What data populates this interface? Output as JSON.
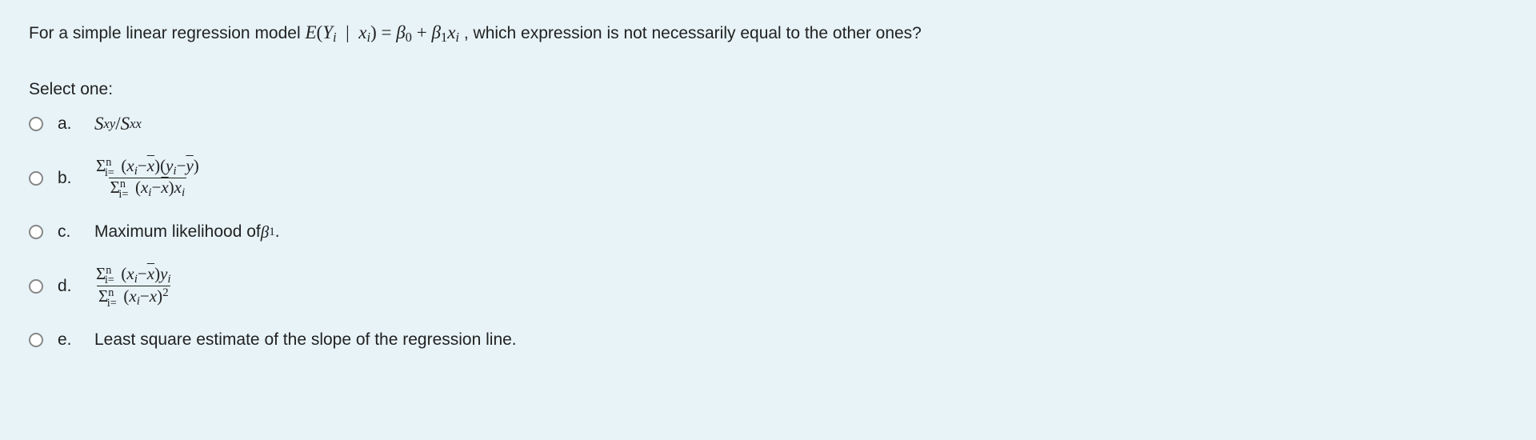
{
  "question": {
    "prefix": "For a simple linear regression model ",
    "formula_html": "<span class='math-i'>E</span>(<span class='math-i'>Y</span><span class='sub'>i</span> &nbsp;|&nbsp; <span class='math-i'>x</span><span class='sub'>i</span>) = <span class='math-i'>β</span><span class='sub' style='font-style:normal'>0</span> + <span class='math-i'>β</span><span class='sub' style='font-style:normal'>1</span><span class='math-i'>x</span><span class='sub'>i</span>",
    "suffix": ", which expression is not necessarily equal to the other ones?"
  },
  "select_one": "Select one:",
  "options": {
    "a": {
      "letter": "a.",
      "content_html": "<span class='math-i'>S</span><span class='sub'>xy</span>/<span class='math-i'>S</span><span class='sub'>xx</span>"
    },
    "b": {
      "letter": "b.",
      "content_html": "<span class='frac'><span class='num'><span class='sigma'>Σ</span><span class='smallscript' style='top:-0.5em'>n</span><span class='smallscript' style='top:0.4em;left:-0.6em'>i=</span>(<span class='math-i'>x</span><span class='sub'>i</span>−<span class='math-i overline'>x</span>)(<span class='math-i'>y</span><span class='sub'>i</span>−<span class='math-i overline'>y</span>)</span><span class='den'><span class='sigma'>Σ</span><span class='smallscript' style='top:-0.5em'>n</span><span class='smallscript' style='top:0.4em;left:-0.6em'>i=</span>(<span class='math-i'>x</span><span class='sub'>i</span>−<span class='math-i overline'>x</span>)<span class='math-i'>x</span><span class='sub'>i</span></span></span>"
    },
    "c": {
      "letter": "c.",
      "content_html": "Maximum likelihood of <span class='math-i'>β</span><span class='sub' style='font-style:normal'>1</span> ."
    },
    "d": {
      "letter": "d.",
      "content_html": "<span class='frac'><span class='num'><span class='sigma'>Σ</span><span class='smallscript' style='top:-0.5em'>n</span><span class='smallscript' style='top:0.4em;left:-0.6em'>i=</span>(<span class='math-i'>x</span><span class='sub'>i</span>−<span class='math-i overline'>x</span>)<span class='math-i'>y</span><span class='sub'>i</span></span><span class='den'><span class='sigma'>Σ</span><span class='smallscript' style='top:-0.5em'>n</span><span class='smallscript' style='top:0.4em;left:-0.6em'>i=</span>(<span class='math-i'>x</span><span class='sub'>i</span>−<span class='math-i overline'>x</span>)<span class='sup' style='font-style:normal'>2</span></span></span>"
    },
    "e": {
      "letter": "e.",
      "content_html": "Least square estimate of the slope of the regression line."
    }
  }
}
